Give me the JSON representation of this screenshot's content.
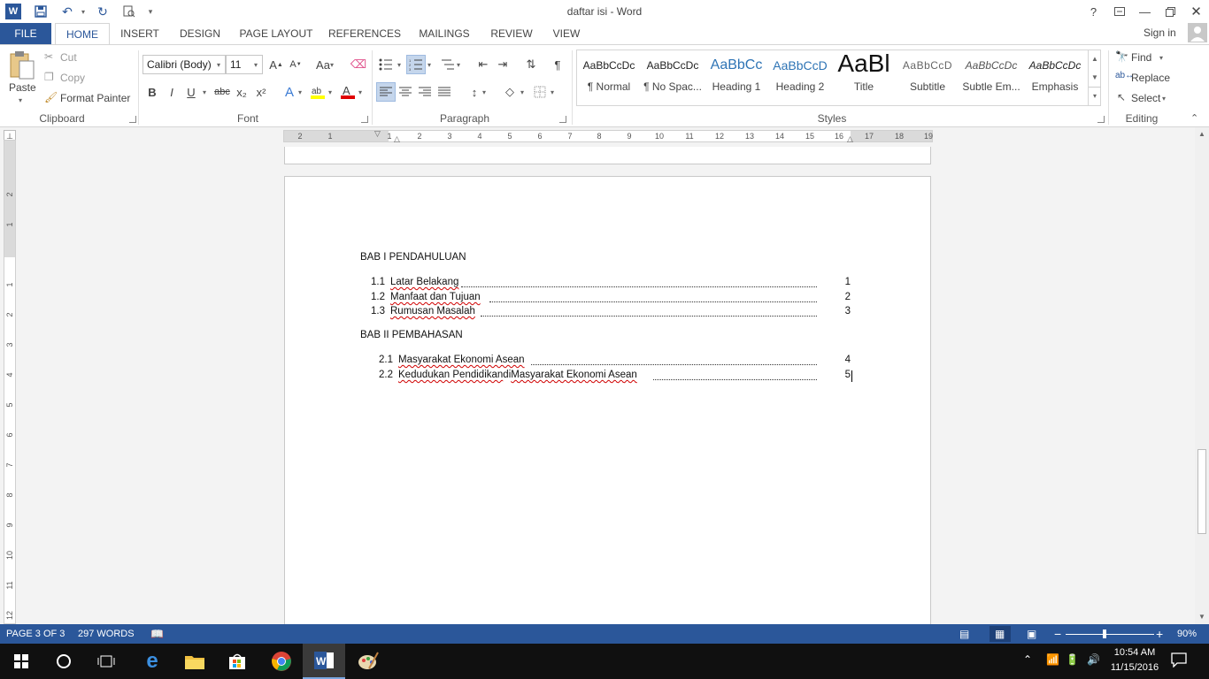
{
  "window": {
    "title": "daftar isi - Word",
    "help": "?",
    "sign_in": "Sign in"
  },
  "tabs": [
    {
      "label": "FILE"
    },
    {
      "label": "HOME"
    },
    {
      "label": "INSERT"
    },
    {
      "label": "DESIGN"
    },
    {
      "label": "PAGE LAYOUT"
    },
    {
      "label": "REFERENCES"
    },
    {
      "label": "MAILINGS"
    },
    {
      "label": "REVIEW"
    },
    {
      "label": "VIEW"
    }
  ],
  "clipboard": {
    "paste": "Paste",
    "cut": "Cut",
    "copy": "Copy",
    "format_painter": "Format Painter",
    "group": "Clipboard"
  },
  "font": {
    "family": "Calibri (Body)",
    "size": "11",
    "group": "Font",
    "bold": "B",
    "italic": "I",
    "underline": "U",
    "strike": "abc",
    "sub": "x₂",
    "sup": "x²",
    "case": "Aa"
  },
  "paragraph": {
    "group": "Paragraph"
  },
  "styles": {
    "group": "Styles",
    "items": [
      {
        "preview": "AaBbCcDc",
        "name": "¶ Normal"
      },
      {
        "preview": "AaBbCcDc",
        "name": "¶ No Spac..."
      },
      {
        "preview": "AaBbCc",
        "name": "Heading 1"
      },
      {
        "preview": "AaBbCcD",
        "name": "Heading 2"
      },
      {
        "preview": "AaBl",
        "name": "Title"
      },
      {
        "preview": "AaBbCcD",
        "name": "Subtitle"
      },
      {
        "preview": "AaBbCcDc",
        "name": "Subtle Em..."
      },
      {
        "preview": "AaBbCcDc",
        "name": "Emphasis"
      }
    ]
  },
  "editing": {
    "find": "Find",
    "replace": "Replace",
    "select": "Select",
    "group": "Editing"
  },
  "ruler": {
    "labels": [
      "2",
      "1",
      "1",
      "2",
      "3",
      "4",
      "5",
      "6",
      "7",
      "8",
      "9",
      "10",
      "11",
      "12",
      "13",
      "14",
      "15",
      "16",
      "17",
      "18",
      "19"
    ],
    "vlabels": [
      "2",
      "1",
      "1",
      "2",
      "3",
      "4",
      "5",
      "6",
      "7",
      "8",
      "9",
      "10",
      "11",
      "12"
    ]
  },
  "document": {
    "chapter1": "BAB I PENDAHULUAN",
    "chapter2": "BAB II PEMBAHASAN",
    "toc1": [
      {
        "num": "1.1",
        "title": "Latar Belakang",
        "page": "1"
      },
      {
        "num": "1.2",
        "title": "Manfaat dan Tujuan",
        "page": "2"
      },
      {
        "num": "1.3",
        "title": "Rumusan Masalah",
        "page": "3"
      }
    ],
    "toc2": [
      {
        "num": "2.1",
        "title": "Masyarakat Ekonomi Asean",
        "page": "4"
      },
      {
        "num": "2.2",
        "title_a": "Kedudukan Pendidikan",
        "title_b": " di ",
        "title_c": "Masyarakat Ekonomi Asean",
        "page": "5"
      }
    ]
  },
  "status": {
    "page": "PAGE 3 OF 3",
    "words": "297 WORDS",
    "zoom": "90%"
  },
  "taskbar": {
    "time": "10:54 AM",
    "date": "11/15/2016"
  },
  "colors": {
    "accent": "#2b579a",
    "spell_error": "#d00000"
  }
}
